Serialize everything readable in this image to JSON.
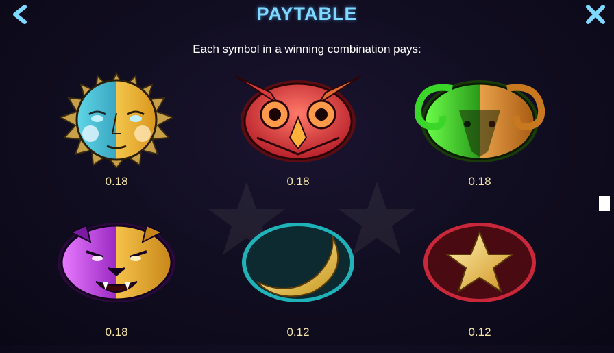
{
  "header": {
    "title": "PAYTABLE",
    "back_icon": "chevron-left-icon",
    "close_icon": "close-icon",
    "accent_color": "#7fd8ff"
  },
  "subtitle": "Each symbol in a winning combination pays:",
  "symbols": [
    {
      "icon": "sun-face-icon",
      "value": "0.18"
    },
    {
      "icon": "owl-icon",
      "value": "0.18"
    },
    {
      "icon": "ram-icon",
      "value": "0.18"
    },
    {
      "icon": "panther-icon",
      "value": "0.18"
    },
    {
      "icon": "crescent-moon-icon",
      "value": "0.12"
    },
    {
      "icon": "star-icon",
      "value": "0.12"
    }
  ],
  "value_color": "#f5e6a8"
}
